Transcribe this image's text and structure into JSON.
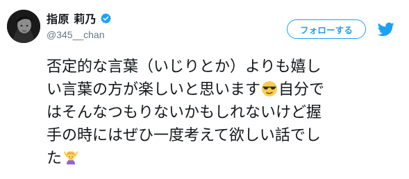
{
  "profile": {
    "display_name": "指原 莉乃",
    "handle": "@345__chan",
    "verified": true,
    "verified_icon": "verified-badge-icon",
    "avatar_icon": "profile-avatar"
  },
  "follow_button": {
    "label": "フォローする"
  },
  "brand": {
    "icon": "twitter-bird-icon",
    "color": "#1da1f2"
  },
  "tweet": {
    "lines": [
      "否定的な言葉（いじりとか）よりも嬉し",
      "い言葉の方が楽しいと思います",
      "自分で",
      "はそんなつもりないかもしれないけど握",
      "手の時にはぜひ一度考えて欲しい話でし",
      "た"
    ],
    "emojis": [
      "sunglasses-emoji",
      "person-gesturing-ok-emoji"
    ]
  },
  "colors": {
    "text": "#14171a",
    "secondary_text": "#657786",
    "accent": "#1da1f2"
  }
}
